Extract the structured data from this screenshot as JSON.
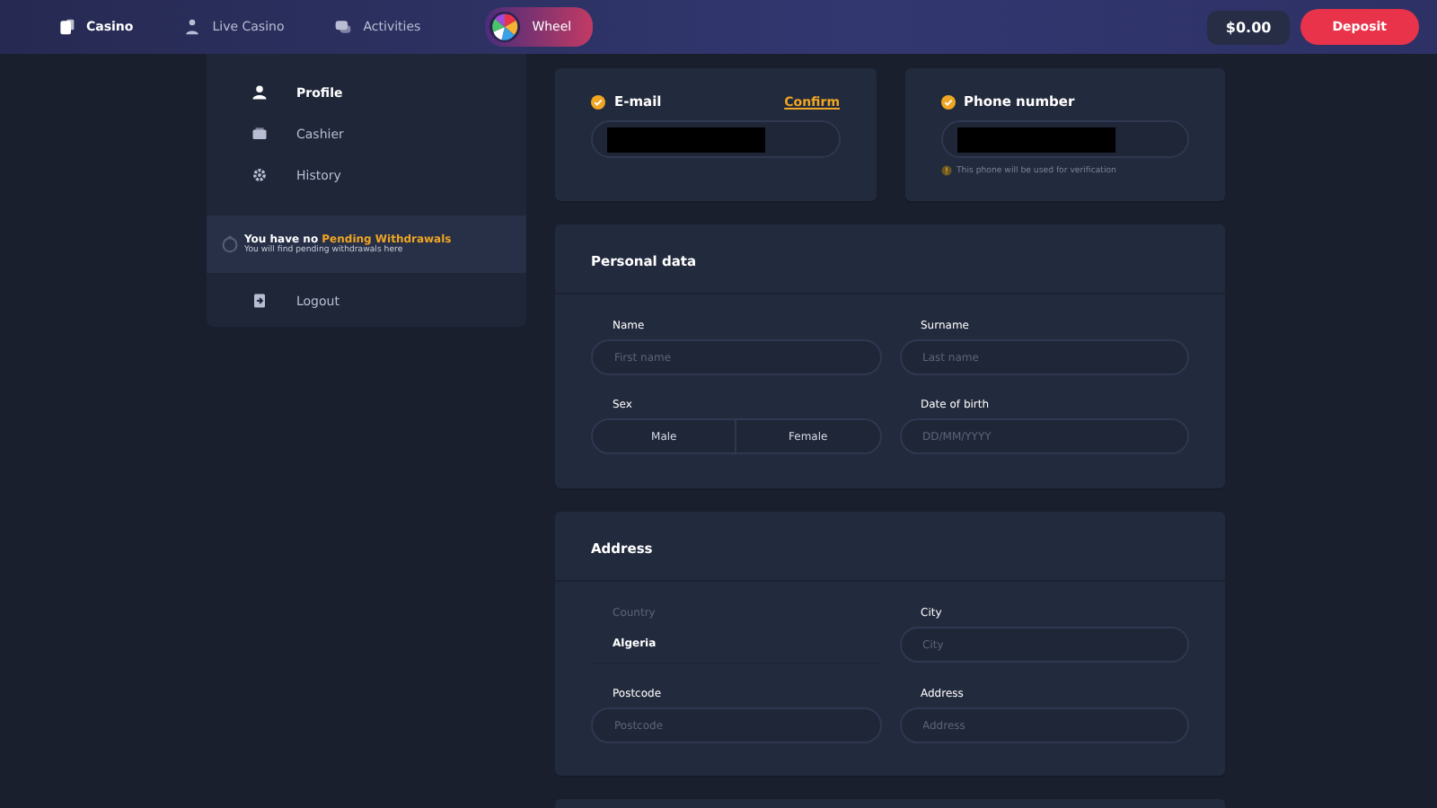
{
  "nav": [
    {
      "label": "Casino",
      "selected": true
    },
    {
      "label": "Live Casino",
      "selected": false
    },
    {
      "label": "Activities",
      "selected": false
    }
  ],
  "wheel": {
    "label": "Wheel"
  },
  "balance": "$0.00",
  "deposit": "Deposit",
  "sidebar": {
    "items": [
      {
        "label": "Profile",
        "selected": true
      },
      {
        "label": "Cashier",
        "selected": false
      },
      {
        "label": "History",
        "selected": false
      }
    ],
    "notice": {
      "title": "You have no **Pending Withdrawals**",
      "text": "You will find pending withdrawals here"
    },
    "logout": "Logout"
  },
  "contact": [
    {
      "label": "E-mail",
      "verified": true,
      "action": "Confirm",
      "redacted": true
    },
    {
      "label": "Phone number",
      "verified": true,
      "redacted": true,
      "hint": "This phone will be used for verification"
    }
  ],
  "personal": {
    "title": "Personal data",
    "fields": [
      {
        "kind": "input",
        "label": "Name",
        "placeholder": "First name"
      },
      {
        "kind": "input",
        "label": "Surname",
        "placeholder": "Last name"
      },
      {
        "kind": "toggle",
        "label": "Sex",
        "options": [
          {
            "label": "Male",
            "selected": false
          },
          {
            "label": "Female",
            "selected": false
          }
        ]
      },
      {
        "kind": "input",
        "label": "Date of birth",
        "placeholder": "DD/MM/YYYY"
      }
    ]
  },
  "address": {
    "title": "Address",
    "fields": [
      {
        "kind": "select",
        "label": "Country",
        "value": "Algeria"
      },
      {
        "kind": "input",
        "label": "City",
        "placeholder": "City"
      },
      {
        "kind": "input",
        "label": "Postcode",
        "placeholder": "Postcode"
      },
      {
        "kind": "input",
        "label": "Address",
        "placeholder": "Address"
      }
    ]
  }
}
